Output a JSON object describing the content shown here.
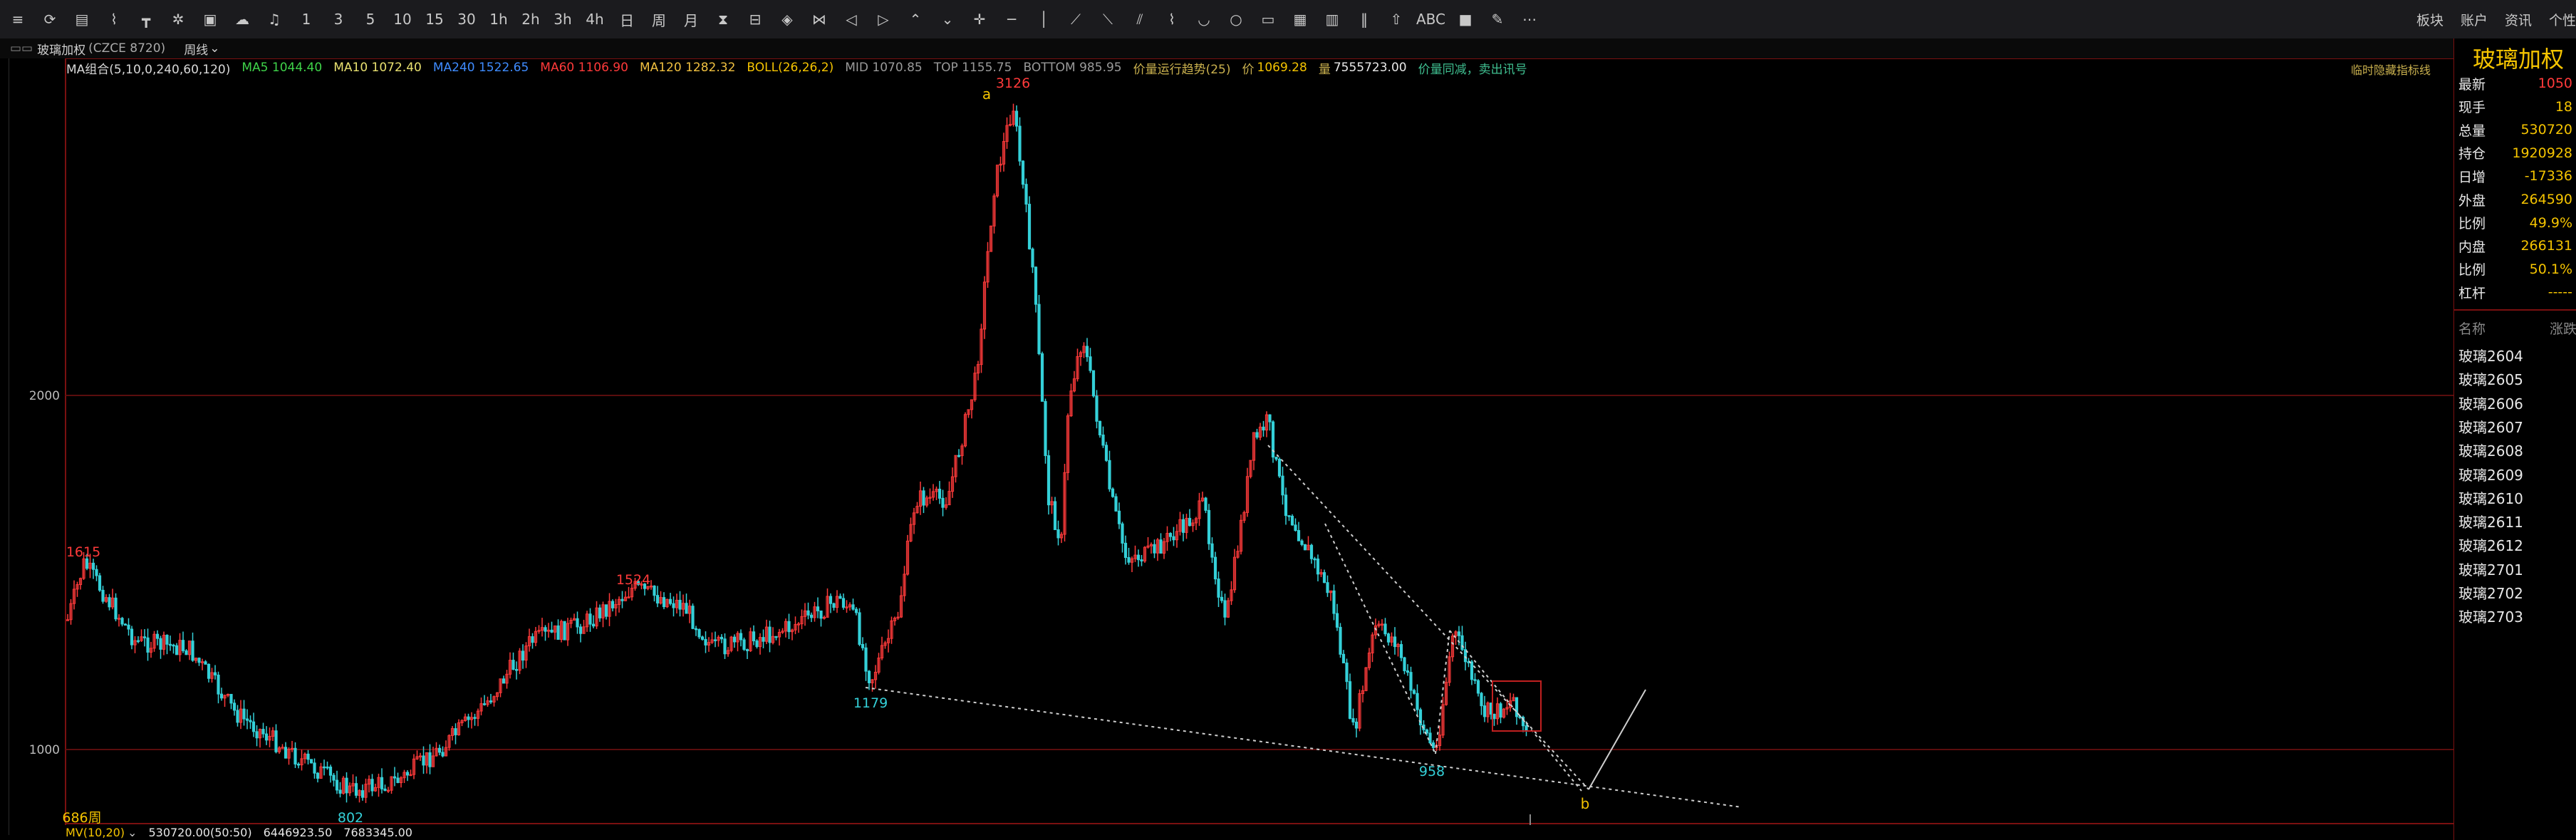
{
  "toolbar": {
    "periods": [
      "1",
      "3",
      "5",
      "10",
      "15",
      "30",
      "1h",
      "2h",
      "3h",
      "4h",
      "日",
      "周",
      "月"
    ],
    "menu": [
      "板块",
      "账户",
      "资讯",
      "个性"
    ]
  },
  "infobar": {
    "title": "玻璃加权",
    "code": "(CZCE 8720)",
    "period": "周线"
  },
  "legend": {
    "ma_group": "MA组合(5,10,0,240,60,120)",
    "ma5": "MA5 1044.40",
    "ma10": "MA10 1072.40",
    "ma240": "MA240 1522.65",
    "ma60": "MA60 1106.90",
    "ma120": "MA120 1282.32",
    "boll": "BOLL(26,26,2)",
    "mid": "MID 1070.85",
    "top": "TOP 1155.75",
    "bottom": "BOTTOM 985.95",
    "trend": "价量运行趋势(25)",
    "price_label": "价",
    "price": "1069.28",
    "vol_label": "量",
    "vol": "7555723.00",
    "signal": "价量同减，卖出讯号",
    "hint": "临时隐藏指标线",
    "colors": {
      "ma_group": "#d8d8d8",
      "ma5": "#3fd34a",
      "ma10": "#e8e070",
      "ma240": "#3f8cff",
      "ma60": "#ff3a3a",
      "ma120": "#f0c040",
      "boll": "#f5c400",
      "mid": "#9a9a9a",
      "top": "#9a9a9a",
      "bottom": "#9a9a9a",
      "trend": "#c9b04e",
      "price": "#f5c400",
      "vol": "#e8e8e8",
      "signal": "#3fbf90"
    }
  },
  "chart": {
    "y_ticks": [
      "2000",
      "1000"
    ],
    "annotations": {
      "a": "a",
      "b": "b",
      "v3126": "3126",
      "v1615": "1615",
      "v1524": "1524",
      "v1179": "1179",
      "v958": "958",
      "v802": "802",
      "v686": "686周"
    }
  },
  "chart_data": {
    "type": "candlestick",
    "title": "玻璃加权",
    "period": "周线",
    "y_axis_ticks": [
      1000,
      2000
    ],
    "labeled_extremes": [
      {
        "label": "1615",
        "value": 1615,
        "kind": "high"
      },
      {
        "label": "802",
        "value": 802,
        "kind": "low"
      },
      {
        "label": "1524",
        "value": 1524,
        "kind": "high"
      },
      {
        "label": "1179",
        "value": 1179,
        "kind": "low"
      },
      {
        "label": "3126",
        "value": 3126,
        "kind": "high",
        "wave": "a"
      },
      {
        "label": "958",
        "value": 958,
        "kind": "low"
      }
    ],
    "wave_labels": [
      "a",
      "b"
    ],
    "last_price": 1069.28,
    "last_volume": 7555723.0
  },
  "bottom": {
    "mv": "MV(10,20)",
    "vol": "530720.00(50:50)",
    "v1": "6446923.50",
    "v2": "7683345.00"
  },
  "quote": {
    "title": "玻璃加权",
    "rows": [
      {
        "label": "最新",
        "value": "1050",
        "color": "#ff3a3a"
      },
      {
        "label": "现手",
        "value": "18",
        "color": "#f5c400"
      },
      {
        "label": "总量",
        "value": "530720",
        "color": "#f5c400"
      },
      {
        "label": "持仓",
        "value": "1920928",
        "color": "#f5c400"
      },
      {
        "label": "日增",
        "value": "-17336",
        "color": "#f5c400"
      },
      {
        "label": "外盘",
        "value": "264590",
        "color": "#f5c400"
      },
      {
        "label": "比例",
        "value": "49.9%",
        "color": "#f5c400"
      },
      {
        "label": "内盘",
        "value": "266131",
        "color": "#f5c400"
      },
      {
        "label": "比例",
        "value": "50.1%",
        "color": "#f5c400"
      },
      {
        "label": "杠杆",
        "value": "-----",
        "color": "#f5c400"
      }
    ],
    "name_header": "名称",
    "change_header": "涨跌",
    "contracts": [
      "玻璃2604",
      "玻璃2605",
      "玻璃2606",
      "玻璃2607",
      "玻璃2608",
      "玻璃2609",
      "玻璃2610",
      "玻璃2611",
      "玻璃2612",
      "玻璃2701",
      "玻璃2702",
      "玻璃2703"
    ]
  }
}
